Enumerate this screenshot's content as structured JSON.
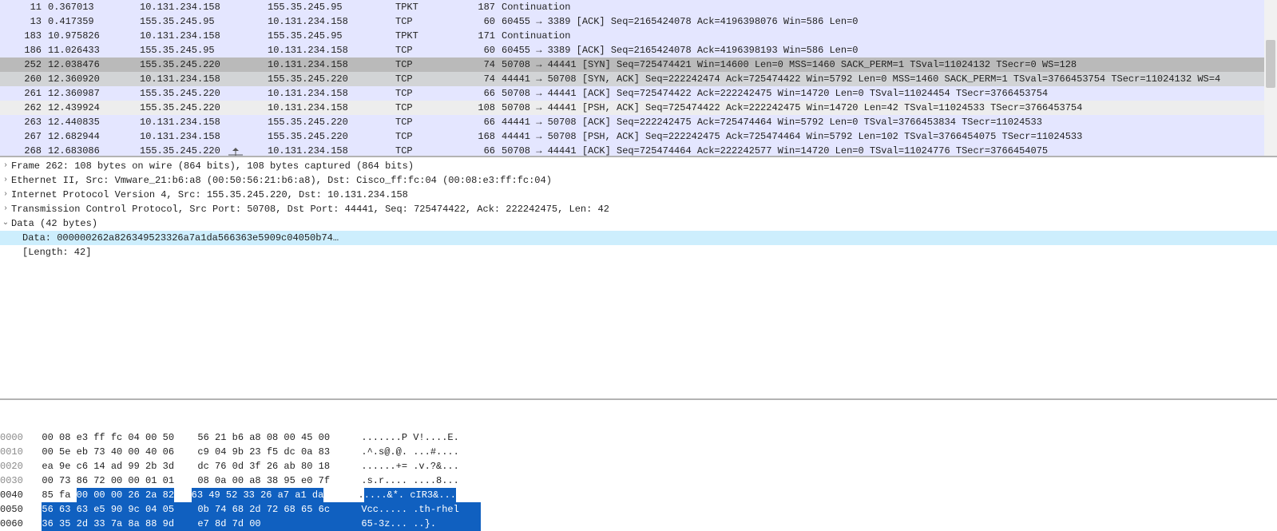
{
  "packets": [
    {
      "no": "11",
      "time": "0.367013",
      "src": "10.131.234.158",
      "dst": "155.35.245.95",
      "proto": "TPKT",
      "len": "187",
      "info": "Continuation",
      "row_bg": "bg-light"
    },
    {
      "no": "13",
      "time": "0.417359",
      "src": "155.35.245.95",
      "dst": "10.131.234.158",
      "proto": "TCP",
      "len": "60",
      "info": "60455 → 3389 [ACK] Seq=2165424078 Ack=4196398076 Win=586 Len=0",
      "row_bg": "bg-light"
    },
    {
      "no": "183",
      "time": "10.975826",
      "src": "10.131.234.158",
      "dst": "155.35.245.95",
      "proto": "TPKT",
      "len": "171",
      "info": "Continuation",
      "row_bg": "bg-light"
    },
    {
      "no": "186",
      "time": "11.026433",
      "src": "155.35.245.95",
      "dst": "10.131.234.158",
      "proto": "TCP",
      "len": "60",
      "info": "60455 → 3389 [ACK] Seq=2165424078 Ack=4196398193 Win=586 Len=0",
      "row_bg": "bg-light"
    },
    {
      "no": "252",
      "time": "12.038476",
      "src": "155.35.245.220",
      "dst": "10.131.234.158",
      "proto": "TCP",
      "len": "74",
      "info": "50708 → 44441 [SYN] Seq=725474421 Win=14600 Len=0 MSS=1460 SACK_PERM=1 TSval=11024132 TSecr=0 WS=128",
      "row_bg": "bg-gray1"
    },
    {
      "no": "260",
      "time": "12.360920",
      "src": "10.131.234.158",
      "dst": "155.35.245.220",
      "proto": "TCP",
      "len": "74",
      "info": "44441 → 50708 [SYN, ACK] Seq=222242474 Ack=725474422 Win=5792 Len=0 MSS=1460 SACK_PERM=1 TSval=3766453754 TSecr=11024132 WS=4",
      "row_bg": "bg-gray2"
    },
    {
      "no": "261",
      "time": "12.360987",
      "src": "155.35.245.220",
      "dst": "10.131.234.158",
      "proto": "TCP",
      "len": "66",
      "info": "50708 → 44441 [ACK] Seq=725474422 Ack=222242475 Win=14720 Len=0 TSval=11024454 TSecr=3766453754",
      "row_bg": "bg-light"
    },
    {
      "no": "262",
      "time": "12.439924",
      "src": "155.35.245.220",
      "dst": "10.131.234.158",
      "proto": "TCP",
      "len": "108",
      "info": "50708 → 44441 [PSH, ACK] Seq=725474422 Ack=222242475 Win=14720 Len=42 TSval=11024533 TSecr=3766453754",
      "row_bg": "bg-sel"
    },
    {
      "no": "263",
      "time": "12.440835",
      "src": "10.131.234.158",
      "dst": "155.35.245.220",
      "proto": "TCP",
      "len": "66",
      "info": "44441 → 50708 [ACK] Seq=222242475 Ack=725474464 Win=5792 Len=0 TSval=3766453834 TSecr=11024533",
      "row_bg": "bg-light"
    },
    {
      "no": "267",
      "time": "12.682944",
      "src": "10.131.234.158",
      "dst": "155.35.245.220",
      "proto": "TCP",
      "len": "168",
      "info": "44441 → 50708 [PSH, ACK] Seq=222242475 Ack=725474464 Win=5792 Len=102 TSval=3766454075 TSecr=11024533",
      "row_bg": "bg-light"
    },
    {
      "no": "268",
      "time": "12.683086",
      "src": "155.35.245.220",
      "dst": "10.131.234.158",
      "proto": "TCP",
      "len": "66",
      "info": "50708 → 44441 [ACK] Seq=725474464 Ack=222242577 Win=14720 Len=0 TSval=11024776 TSecr=3766454075",
      "row_bg": "bg-light"
    }
  ],
  "details": {
    "lines": [
      {
        "caret": "right",
        "text": "Frame 262: 108 bytes on wire (864 bits), 108 bytes captured (864 bits)",
        "hl": false
      },
      {
        "caret": "right",
        "text": "Ethernet II, Src: Vmware_21:b6:a8 (00:50:56:21:b6:a8), Dst: Cisco_ff:fc:04 (00:08:e3:ff:fc:04)",
        "hl": false
      },
      {
        "caret": "right",
        "text": "Internet Protocol Version 4, Src: 155.35.245.220, Dst: 10.131.234.158",
        "hl": false
      },
      {
        "caret": "right",
        "text": "Transmission Control Protocol, Src Port: 50708, Dst Port: 44441, Seq: 725474422, Ack: 222242475, Len: 42",
        "hl": false
      },
      {
        "caret": "down",
        "text": "Data (42 bytes)",
        "hl": false
      }
    ],
    "sub": [
      {
        "text": "Data: 000000262a826349523326a7a1da566363e5909c04050b74…",
        "hl": true
      },
      {
        "text": "[Length: 42]",
        "hl": false
      }
    ]
  },
  "hex": [
    {
      "off": "0000",
      "b1": "00 08 e3 ff fc 04 00 50",
      "b2": "56 21 b6 a8 08 00 45 00",
      "ascii": ".......P V!....E.",
      "hl_b1_from": 0,
      "hl_ascii_from": 0
    },
    {
      "off": "0010",
      "b1": "00 5e eb 73 40 00 40 06",
      "b2": "c9 04 9b 23 f5 dc 0a 83",
      "ascii": ".^.s@.@. ...#....",
      "hl_b1_from": 0,
      "hl_ascii_from": 0
    },
    {
      "off": "0020",
      "b1": "ea 9e c6 14 ad 99 2b 3d",
      "b2": "dc 76 0d 3f 26 ab 80 18",
      "ascii": "......+= .v.?&...",
      "hl_b1_from": 0,
      "hl_ascii_from": 0
    },
    {
      "off": "0030",
      "b1": "00 73 86 72 00 00 01 01",
      "b2": "08 0a 00 a8 38 95 e0 7f",
      "ascii": ".s.r.... ....8...",
      "hl_b1_from": 0,
      "hl_ascii_from": 0
    },
    {
      "off": "0040",
      "b1_a": "85 fa ",
      "b1_b": "00 00 00 26 2a 82",
      "b2": "63 49 52 33 26 a7 a1 da",
      "ascii_a": ".",
      "ascii_b": "....&*. cIR3&...",
      "partial": true
    },
    {
      "off": "0050",
      "b1": "56 63 63 e5 90 9c 04 05",
      "b2": "0b 74 68 2d 72 68 65 6c",
      "ascii": "Vcc..... .th-rhel",
      "full_hl": true
    },
    {
      "off": "0060",
      "b1": "36 35 2d 33 7a 8a 88 9d",
      "b2": "e7 8d 7d 00",
      "ascii": "65-3z... ..}.",
      "full_hl": true
    }
  ]
}
